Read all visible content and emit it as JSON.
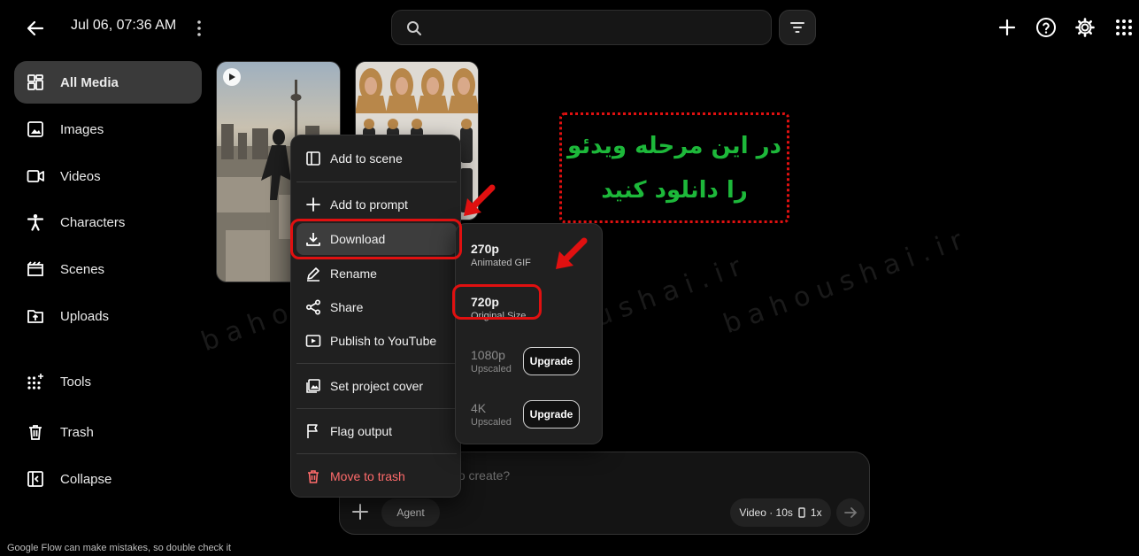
{
  "header": {
    "date": "Jul 06, 07:36 AM",
    "search": {
      "placeholder": ""
    }
  },
  "sidebar": {
    "items": [
      {
        "label": "All Media",
        "icon": "grid-icon"
      },
      {
        "label": "Images",
        "icon": "image-icon"
      },
      {
        "label": "Videos",
        "icon": "video-icon"
      },
      {
        "label": "Characters",
        "icon": "person-icon"
      },
      {
        "label": "Scenes",
        "icon": "clapper-icon"
      },
      {
        "label": "Uploads",
        "icon": "upload-folder-icon"
      },
      {
        "label": "Tools",
        "icon": "dots-grid-icon"
      },
      {
        "label": "Trash",
        "icon": "trash-icon"
      },
      {
        "label": "Collapse",
        "icon": "collapse-icon"
      }
    ]
  },
  "context_menu": {
    "items": [
      {
        "label": "Add to scene"
      },
      {
        "label": "Add to prompt"
      },
      {
        "label": "Download"
      },
      {
        "label": "Rename"
      },
      {
        "label": "Share"
      },
      {
        "label": "Publish to YouTube"
      },
      {
        "label": "Set project cover"
      },
      {
        "label": "Flag output"
      },
      {
        "label": "Move to trash"
      }
    ]
  },
  "download_menu": {
    "options": [
      {
        "title": "270p",
        "subtitle": "Animated GIF"
      },
      {
        "title": "720p",
        "subtitle": "Original Size"
      },
      {
        "title": "1080p",
        "subtitle": "Upscaled",
        "action": "Upgrade"
      },
      {
        "title": "4K",
        "subtitle": "Upscaled",
        "action": "Upgrade"
      }
    ]
  },
  "annotation": {
    "line1": "در این مرحله ویدئو",
    "line2": "را دانلود کنید"
  },
  "prompt_bar": {
    "placeholder": "What do you want to create?",
    "agent": "Agent",
    "settings": "Video · 10s",
    "multiplier": "1x"
  },
  "watermark": "bahoushai.ir",
  "footer": {
    "note": "Google Flow can make mistakes, so double check it"
  },
  "colors": {
    "background": "#000000",
    "active_nav": "#3a3a3a",
    "menu_bg": "#202020",
    "highlight_red": "#e01010",
    "annotation_green": "#1db83a",
    "danger": "#ff6b6b"
  }
}
